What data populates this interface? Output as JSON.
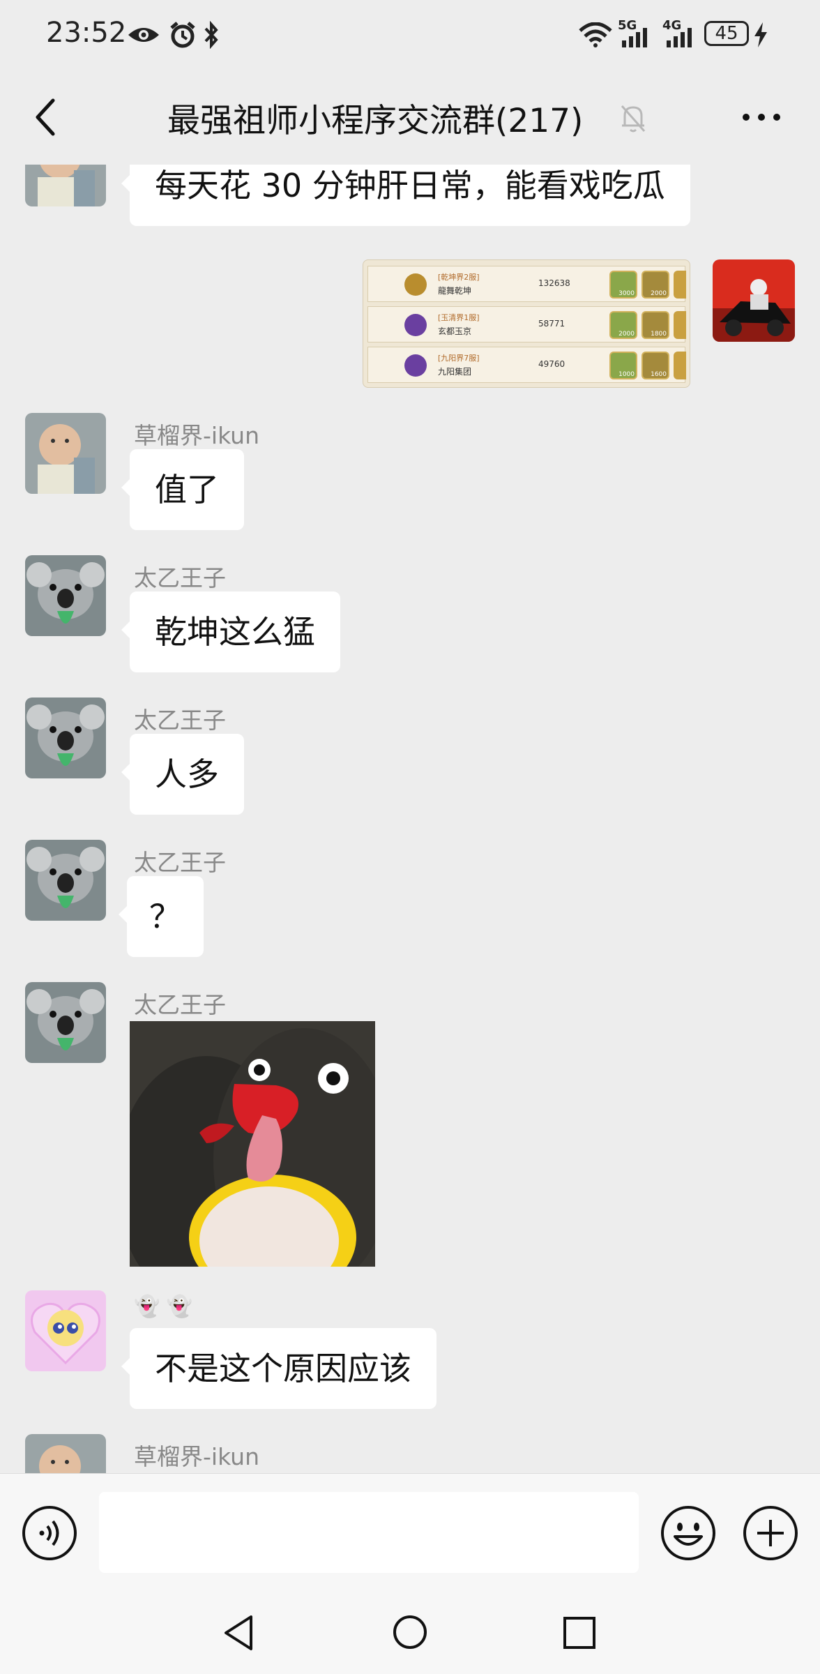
{
  "status_bar": {
    "time": "23:52",
    "signal_1_label": "5G",
    "signal_2_label": "4G",
    "battery": "45"
  },
  "header": {
    "title": "最强祖师小程序交流群(217)"
  },
  "screenshot_message": {
    "rows": [
      {
        "server": "[乾坤界2服]",
        "guild": "龍舞乾坤",
        "score": "132638",
        "r1": "3000",
        "r2": "2000"
      },
      {
        "server": "[玉清界1服]",
        "guild": "玄都玉京",
        "score": "58771",
        "r1": "2000",
        "r2": "1800"
      },
      {
        "server": "[九阳界7服]",
        "guild": "九阳集团",
        "score": "49760",
        "r1": "1000",
        "r2": "1600"
      }
    ]
  },
  "messages": [
    {
      "text": "每天花 30 分钟肝日常，能看戏吃瓜"
    },
    {
      "sender": "草榴界-ikun",
      "text": "值了"
    },
    {
      "sender": "太乙王子",
      "text": "乾坤这么猛"
    },
    {
      "sender": "太乙王子",
      "text": "人多"
    },
    {
      "sender": "太乙王子",
      "text": "？"
    },
    {
      "sender": "太乙王子"
    },
    {
      "sender": "👻 👻",
      "text": "不是这个原因应该"
    },
    {
      "sender": "草榴界-ikun"
    }
  ],
  "input": {
    "value": ""
  },
  "icons": {
    "voice": "voice-icon",
    "emoji": "emoji-icon",
    "plus": "plus-icon",
    "back": "back-arrow-icon",
    "more": "more-icon",
    "mute": "mute-bell-icon"
  },
  "colors": {
    "background": "#ededed",
    "bubble": "#ffffff",
    "nickname": "#888888"
  }
}
